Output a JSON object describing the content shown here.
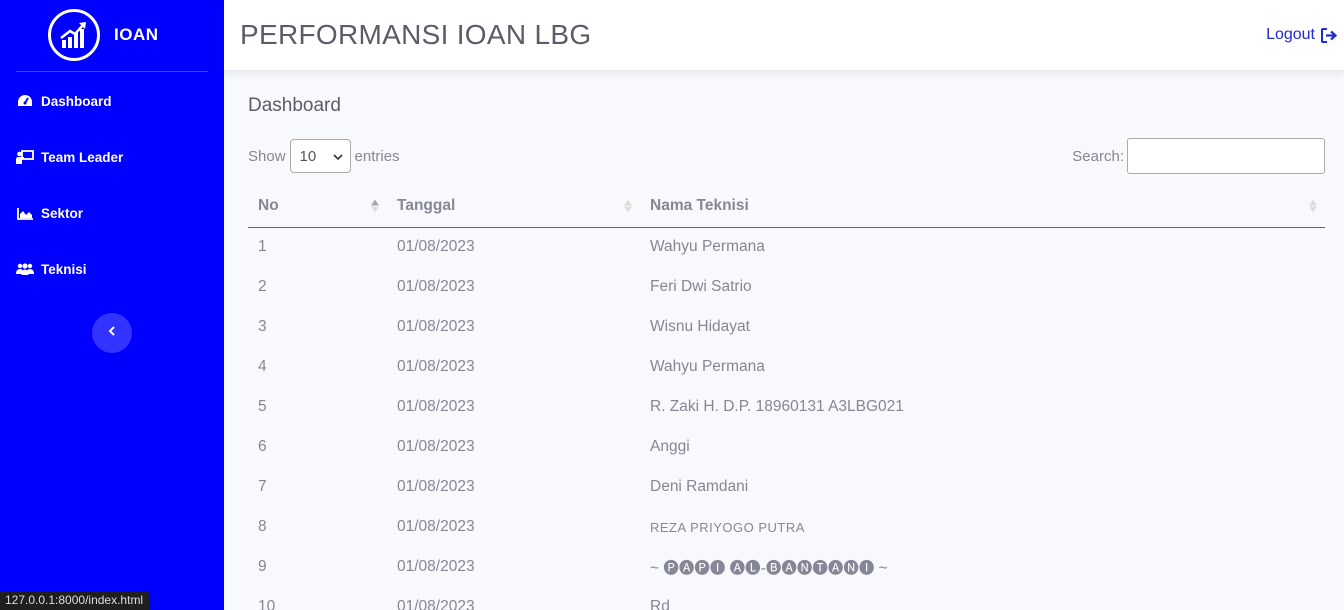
{
  "brand": {
    "name": "IOAN"
  },
  "sidebar": {
    "items": [
      {
        "label": "Dashboard",
        "icon": "tachometer-icon"
      },
      {
        "label": "Team Leader",
        "icon": "chalkboard-teacher-icon"
      },
      {
        "label": "Sektor",
        "icon": "area-chart-icon"
      },
      {
        "label": "Teknisi",
        "icon": "users-icon"
      }
    ],
    "toggle_icon": "chevron-left-icon"
  },
  "header": {
    "title": "PERFORMANSI IOAN LBG",
    "logout_label": "Logout",
    "logout_icon": "sign-out-icon"
  },
  "main": {
    "title": "Dashboard",
    "show_label": "Show",
    "entries_value": "10",
    "entries_label": "entries",
    "search_label": "Search:",
    "search_value": "",
    "table": {
      "columns": [
        "No",
        "Tanggal",
        "Nama Teknisi"
      ],
      "rows": [
        [
          "1",
          "01/08/2023",
          "Wahyu Permana"
        ],
        [
          "2",
          "01/08/2023",
          "Feri Dwi Satrio"
        ],
        [
          "3",
          "01/08/2023",
          "Wisnu Hidayat"
        ],
        [
          "4",
          "01/08/2023",
          "Wahyu Permana"
        ],
        [
          "5",
          "01/08/2023",
          "R. Zaki H. D.P. 18960131 A3LBG021"
        ],
        [
          "6",
          "01/08/2023",
          "Anggi"
        ],
        [
          "7",
          "01/08/2023",
          "Deni Ramdani"
        ],
        [
          "8",
          "01/08/2023",
          "REZA PRIYOGO PUTRA"
        ],
        [
          "9",
          "01/08/2023",
          "~ 🅟🅐🅟🅘 🅐🅛-🅑🅐🅝🅣🅐🅝🅘 ~"
        ],
        [
          "10",
          "01/08/2023",
          "Rd"
        ]
      ]
    }
  },
  "statusbar": {
    "url": "127.0.0.1:8000/index.html"
  },
  "colors": {
    "sidebar": "#0000ff",
    "accent": "#1d2bd0",
    "text": "#858796",
    "heading": "#5a5c69"
  }
}
